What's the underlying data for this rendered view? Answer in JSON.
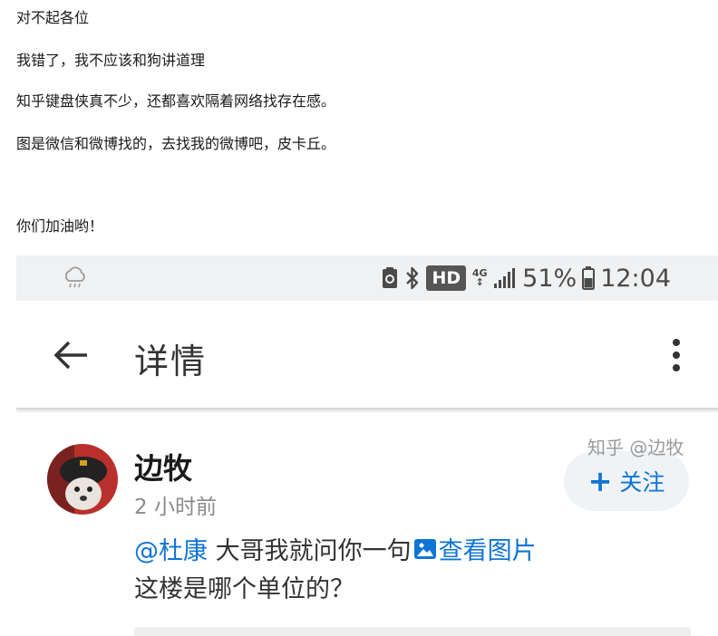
{
  "article": {
    "paragraphs": [
      "对不起各位",
      "我错了，我不应该和狗讲道理",
      "知乎键盘侠真不少，还都喜欢隔着网络找存在感。",
      "图是微信和微博找的，去找我的微博吧，皮卡丘。",
      "你们加油哟！"
    ]
  },
  "screenshot": {
    "status_bar": {
      "weather_icon": "cloud-rain-icon",
      "hd_label": "HD",
      "network_label": "4G",
      "battery_percent": "51%",
      "time": "12:04"
    },
    "toolbar": {
      "title": "详情",
      "back_icon": "arrow-left-icon",
      "more_icon": "more-vertical-icon"
    },
    "comment": {
      "username": "边牧",
      "time_ago": "2 小时前",
      "follow": {
        "plus": "+",
        "label": "关注"
      },
      "mention": "@杜康",
      "text_part1": " 大哥我就问你一句",
      "image_link_label": "查看图片",
      "text_line2": "这楼是哪个单位的？"
    },
    "watermark": "知乎 @边牧"
  },
  "colors": {
    "accent": "#0f74d3",
    "status_bg": "#f0f1f2",
    "text": "#1a1a1a"
  }
}
